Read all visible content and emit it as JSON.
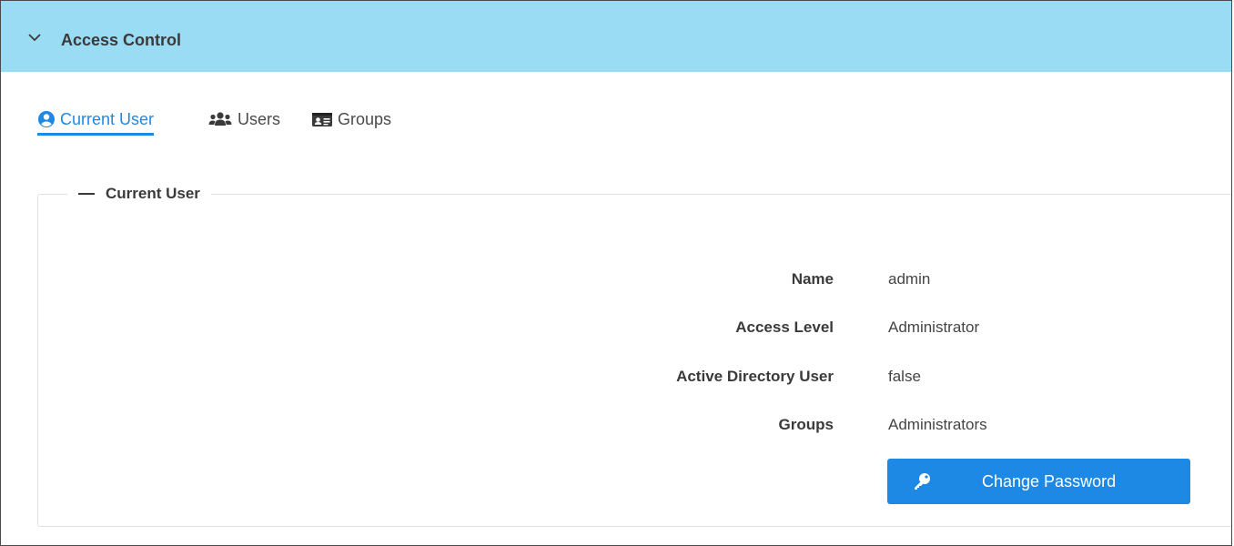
{
  "panel": {
    "title": "Access Control",
    "header_color": "#9bdcf5",
    "collapse_icon": "chevron-down-icon"
  },
  "tabs": [
    {
      "label": "Current User",
      "icon": "user-circle-icon",
      "active": true
    },
    {
      "label": "Users",
      "icon": "users-icon",
      "active": false
    },
    {
      "label": "Groups",
      "icon": "id-card-icon",
      "active": false
    }
  ],
  "section": {
    "legend": "Current User",
    "fields": [
      {
        "label": "Name",
        "value": "admin"
      },
      {
        "label": "Access Level",
        "value": "Administrator"
      },
      {
        "label": "Active Directory User",
        "value": "false"
      },
      {
        "label": "Groups",
        "value": "Administrators"
      }
    ],
    "change_password": {
      "label": "Change Password",
      "icon": "key-icon"
    }
  },
  "colors": {
    "accent": "#1e88e5",
    "text": "#3a3a3a"
  }
}
